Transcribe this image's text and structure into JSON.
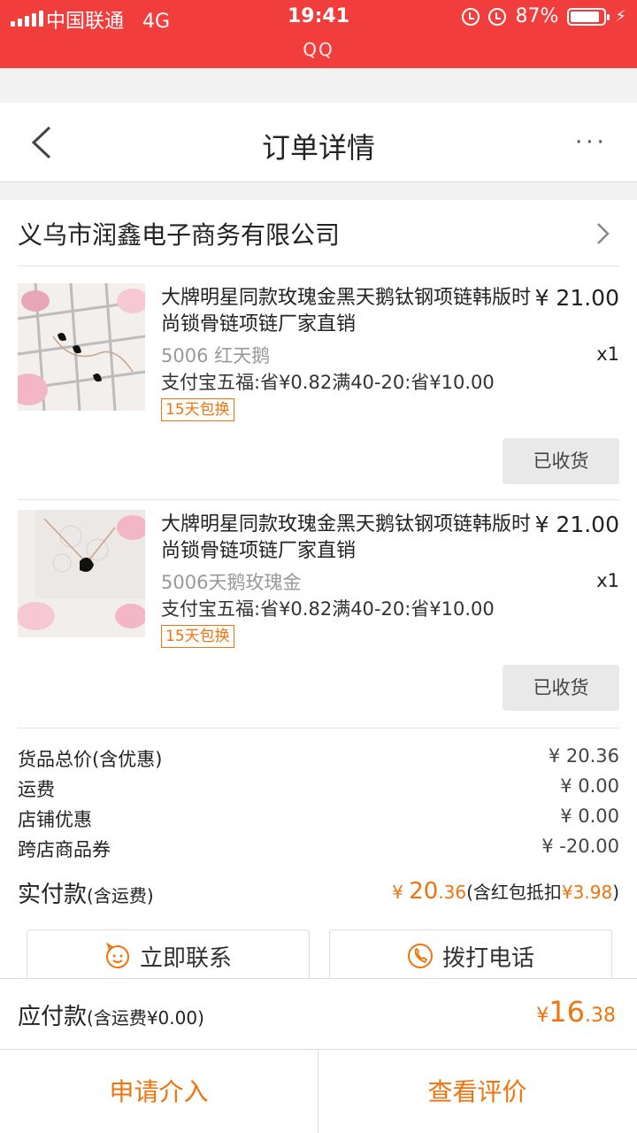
{
  "status_bar": {
    "carrier": "中国联通",
    "network": "4G",
    "time": "19:41",
    "battery": "87%",
    "battery_level": 0.87,
    "app_name": "QQ"
  },
  "nav": {
    "title": "订单详情",
    "more": "···"
  },
  "shop": {
    "name": "义乌市润鑫电子商务有限公司"
  },
  "items": [
    {
      "title": "大牌明星同款玫瑰金黑天鹅钛钢项链韩版时尚锁骨链项链厂家直销",
      "price": "¥ 21.00",
      "sku": "5006 红天鹅",
      "qty": "x1",
      "promo": "支付宝五福:省¥0.82满40-20:省¥10.00",
      "tag": "15天包换",
      "status_button": "已收货"
    },
    {
      "title": "大牌明星同款玫瑰金黑天鹅钛钢项链韩版时尚锁骨链项链厂家直销",
      "price": "¥ 21.00",
      "sku": "5006天鹅玫瑰金",
      "qty": "x1",
      "promo": "支付宝五福:省¥0.82满40-20:省¥10.00",
      "tag": "15天包换",
      "status_button": "已收货"
    }
  ],
  "summary": {
    "rows": [
      {
        "label": "货品总价(含优惠)",
        "value": "¥ 20.36"
      },
      {
        "label": "运费",
        "value": "¥ 0.00"
      },
      {
        "label": "店铺优惠",
        "value": "¥ 0.00"
      },
      {
        "label": "跨店商品券",
        "value": "¥ -20.00"
      }
    ],
    "paid_label": "实付款",
    "paid_label_note": "(含运费)",
    "paid_currency": "¥ ",
    "paid_int": "20",
    "paid_dec": ".36",
    "paid_note_prefix": "(含红包抵扣",
    "paid_note_value": "¥3.98",
    "paid_note_suffix": ")"
  },
  "contact": {
    "chat_label": "立即联系",
    "call_label": "拨打电话"
  },
  "due": {
    "label": "应付款",
    "note": "(含运费¥0.00)",
    "currency": "¥",
    "int": "16",
    "dec": ".38"
  },
  "actions": {
    "dispute_label": "申请介入",
    "review_label": "查看评价"
  },
  "colors": {
    "status_bar": "#f23d3d",
    "accent": "#f0730d"
  }
}
